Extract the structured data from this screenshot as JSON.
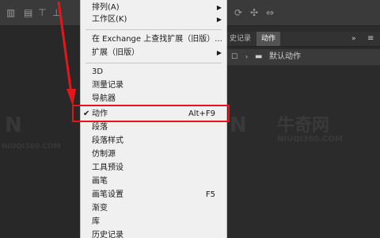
{
  "menu": {
    "items_top": [
      {
        "label": "排列(A)",
        "submenu": true
      },
      {
        "label": "工作区(K)",
        "submenu": true
      }
    ],
    "items_mid": [
      {
        "label": "在 Exchange 上查找扩展（旧版）...",
        "submenu": false
      },
      {
        "label": "扩展（旧版）",
        "submenu": true
      }
    ],
    "items_panels": [
      {
        "label": "3D",
        "shortcut": "",
        "checked": false
      },
      {
        "label": "测量记录",
        "shortcut": "",
        "checked": false
      },
      {
        "label": "导航器",
        "shortcut": "",
        "checked": false
      },
      {
        "label": "动作",
        "shortcut": "Alt+F9",
        "checked": true
      },
      {
        "label": "段落",
        "shortcut": "",
        "checked": false
      },
      {
        "label": "段落样式",
        "shortcut": "",
        "checked": false
      },
      {
        "label": "仿制源",
        "shortcut": "",
        "checked": false
      },
      {
        "label": "工具预设",
        "shortcut": "",
        "checked": false
      },
      {
        "label": "画笔",
        "shortcut": "",
        "checked": false
      },
      {
        "label": "画笔设置",
        "shortcut": "F5",
        "checked": false
      },
      {
        "label": "渐变",
        "shortcut": "",
        "checked": false
      },
      {
        "label": "库",
        "shortcut": "",
        "checked": false
      },
      {
        "label": "历史记录",
        "shortcut": "",
        "checked": false
      }
    ],
    "checkmark": "✔",
    "submenu_arrow": "▶"
  },
  "panel": {
    "tabs": [
      "史记录",
      "动作"
    ],
    "active_tab": "动作",
    "row_label": "默认动作",
    "menu_icon": "≡",
    "collapse_icon": "»"
  },
  "watermark": {
    "text": "NIUQI360.COM",
    "brand": "牛奇网"
  },
  "colors": {
    "highlight": "#e4161b",
    "menu_bg": "#f0f0f0"
  }
}
